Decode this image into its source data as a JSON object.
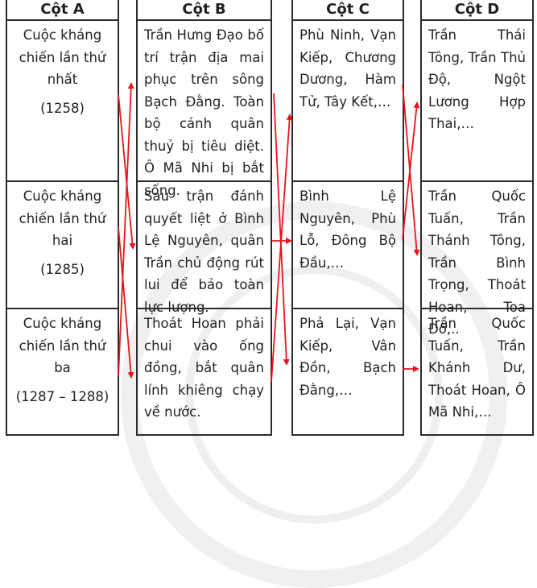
{
  "table": {
    "headers": [
      "Cột A",
      "Cột B",
      "Cột C",
      "Cột D"
    ],
    "column_a": [
      {
        "label": "Cuộc kháng chiến lần thứ nhất",
        "year": "(1258)"
      },
      {
        "label": "Cuộc kháng chiến lần thứ hai",
        "year": "(1285)"
      },
      {
        "label": "Cuộc kháng chiến lần thứ ba",
        "year": "(1287 – 1288)"
      }
    ],
    "column_b": [
      "Trần Hưng Đạo bố trí trận địa mai phục trên sông Bạch Đằng. Toàn bộ cánh quân thuỷ bị tiêu diệt. Ô Mã Nhi bị bắt sống.",
      "Sau trận đánh quyết liệt ở Bình Lệ Nguyên, quân Trần chủ động rút lui để bảo toàn lực lượng.",
      "Thoát Hoan phải chui vào ống đồng, bắt quân lính khiêng chạy về nước."
    ],
    "column_c": [
      "Phù Ninh, Vạn Kiếp, Chương Dương, Hàm Tử, Tây Kết,…",
      "Bình Lệ Nguyên, Phù Lỗ, Đông Bộ Đầu,…",
      "Phả Lại, Vạn Kiếp, Vân Đồn, Bạch Đằng,…"
    ],
    "column_d": [
      "Trần Thái Tông, Trần Thủ Độ, Ngột Lương Hợp Thai,…",
      "Trần Quốc Tuấn, Trần Thánh Tông, Trần Bình Trọng, Thoát Hoan, Toa Đô,..",
      "Trần Quốc Tuấn, Trần Khánh Dư, Thoát Hoan, Ô Mã Nhi,…"
    ]
  },
  "connections": [
    {
      "from": "A1",
      "to": "B2"
    },
    {
      "from": "A2",
      "to": "B3"
    },
    {
      "from": "A3",
      "to": "B1"
    },
    {
      "from": "B1",
      "to": "C3"
    },
    {
      "from": "B2",
      "to": "C2"
    },
    {
      "from": "B3",
      "to": "C1"
    },
    {
      "from": "C1",
      "to": "D2"
    },
    {
      "from": "C2",
      "to": "D1"
    },
    {
      "from": "C3",
      "to": "D3"
    }
  ],
  "colors": {
    "arrow": "#e8141b",
    "border": "#2b2b2b",
    "text": "#231f20"
  }
}
